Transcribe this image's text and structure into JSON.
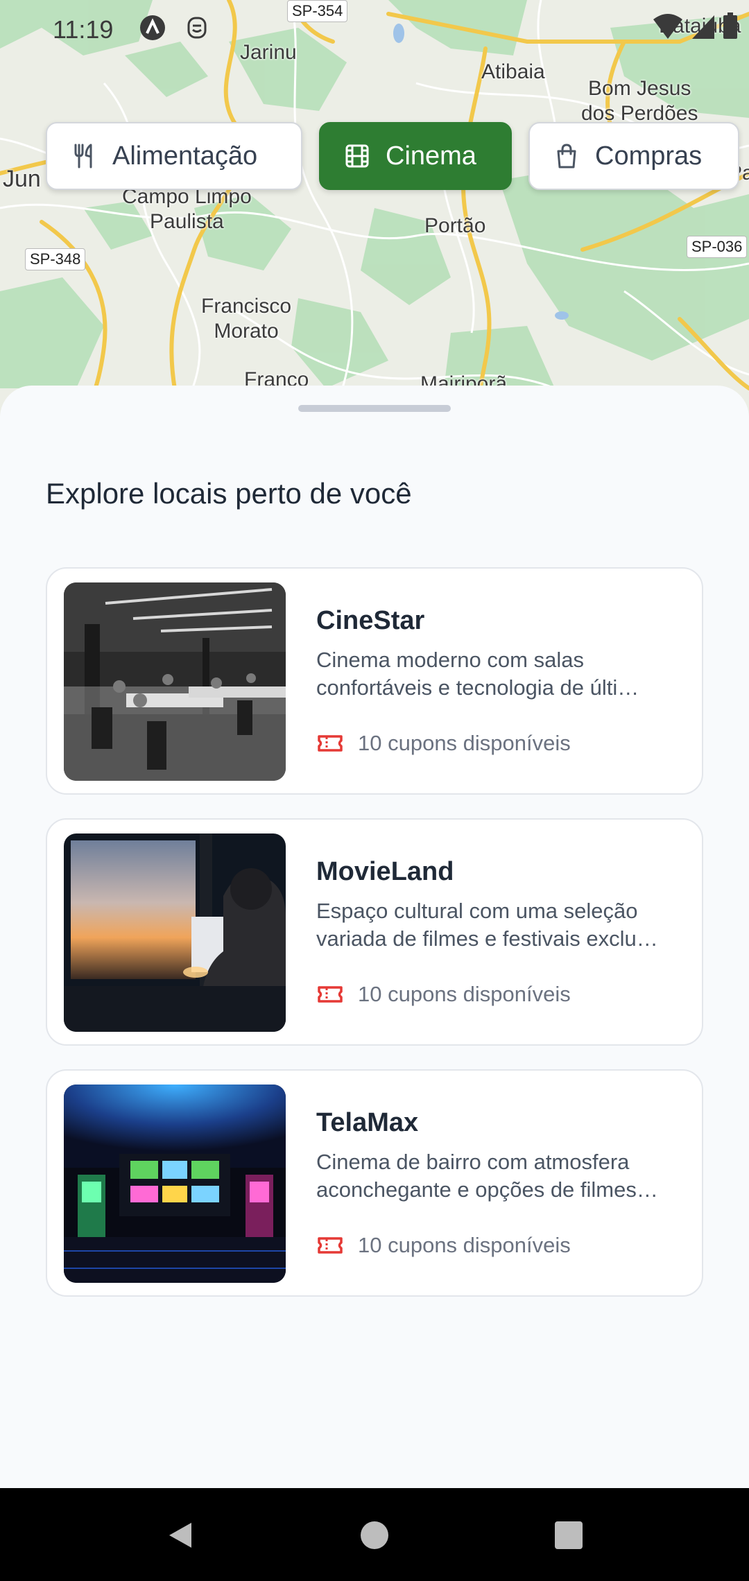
{
  "status_bar": {
    "time": "11:19",
    "icons": [
      "a-logo-icon",
      "face-icon",
      "wifi-icon",
      "signal-icon",
      "battery-icon"
    ]
  },
  "map": {
    "places": [
      {
        "id": "jarinu",
        "label": "Jarinu"
      },
      {
        "id": "atibaia",
        "label": "Atibaia"
      },
      {
        "id": "bom-jesus",
        "label": "Bom Jesus\ndos Perdões"
      },
      {
        "id": "campo-limpo",
        "label": "Campo Limpo\nPaulista"
      },
      {
        "id": "portao",
        "label": "Portão"
      },
      {
        "id": "francisco-morato",
        "label": "Francisco\nMorato"
      },
      {
        "id": "franco",
        "label": "Franco"
      },
      {
        "id": "mairipora",
        "label": "Mairiporã"
      },
      {
        "id": "jundiai",
        "label": "Jun"
      },
      {
        "id": "bateias",
        "label": "Bataiuba"
      },
      {
        "id": "piracaia-edge",
        "label": "Pa"
      }
    ],
    "shields": [
      {
        "id": "sp354",
        "label": "SP-354"
      },
      {
        "id": "sp348",
        "label": "SP-348"
      },
      {
        "id": "sp036",
        "label": "SP-036"
      }
    ]
  },
  "categories": [
    {
      "label": "Alimentação",
      "icon": "fork-knife-icon",
      "active": false
    },
    {
      "label": "Cinema",
      "icon": "film-icon",
      "active": true
    },
    {
      "label": "Compras",
      "icon": "shopping-bag-icon",
      "active": false
    }
  ],
  "sheet": {
    "title": "Explore locais perto de você",
    "places": [
      {
        "name": "CineStar",
        "desc_line1": "Cinema moderno com salas",
        "desc_line2": "confortáveis e tecnologia de últi…",
        "coupons": "10 cupons disponíveis"
      },
      {
        "name": "MovieLand",
        "desc_line1": "Espaço cultural com uma seleção",
        "desc_line2": "variada de filmes e festivais exclu…",
        "coupons": "10 cupons disponíveis"
      },
      {
        "name": "TelaMax",
        "desc_line1": "Cinema de bairro com atmosfera",
        "desc_line2": "aconchegante e opções de filmes…",
        "coupons": "10 cupons disponíveis"
      }
    ]
  },
  "colors": {
    "accent": "#2e7d32",
    "coupon_icon": "#e53935"
  }
}
